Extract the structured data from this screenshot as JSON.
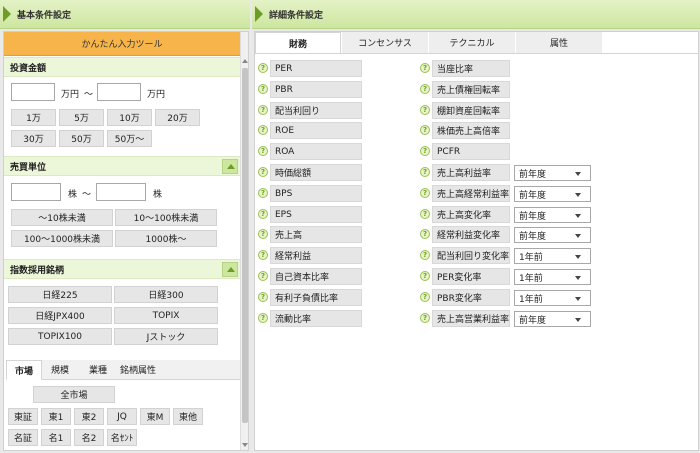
{
  "left": {
    "header": "基本条件設定",
    "easy_tool": "かんたん入力ツール",
    "investment": {
      "title": "投資金額",
      "unit1": "万円",
      "tilde": "～",
      "unit2": "万円",
      "buttons": [
        "1万",
        "5万",
        "10万",
        "20万",
        "30万",
        "50万",
        "50万～"
      ]
    },
    "trading_unit": {
      "title": "売買単位",
      "unit1": "株",
      "tilde": "～",
      "unit2": "株",
      "buttons": [
        "～10株未満",
        "10～100株未満",
        "100～1000株未満",
        "1000株～"
      ]
    },
    "index": {
      "title": "指数採用銘柄",
      "buttons": [
        "日経225",
        "日経300",
        "日経JPX400",
        "TOPIX",
        "TOPIX100",
        "Jストック"
      ]
    },
    "market_tabs": [
      "市場",
      "規模",
      "業種",
      "銘柄属性"
    ],
    "markets": [
      "全市場",
      "東証",
      "東1",
      "東2",
      "JQ",
      "東M",
      "東他",
      "名証",
      "名1",
      "名2",
      "名ｾﾝﾄ"
    ]
  },
  "right": {
    "header": "詳細条件設定",
    "tabs": [
      "財務",
      "コンセンサス",
      "テクニカル",
      "属性"
    ],
    "help_glyph": "?",
    "col1": [
      "PER",
      "PBR",
      "配当利回り",
      "ROE",
      "ROA",
      "時価総額",
      "BPS",
      "EPS",
      "売上高",
      "経常利益",
      "自己資本比率",
      "有利子負債比率",
      "流動比率"
    ],
    "col2": [
      {
        "label": "当座比率"
      },
      {
        "label": "売上債権回転率"
      },
      {
        "label": "棚卸資産回転率"
      },
      {
        "label": "株価売上高倍率"
      },
      {
        "label": "PCFR"
      },
      {
        "label": "売上高利益率",
        "select": "前年度"
      },
      {
        "label": "売上高経常利益率",
        "select": "前年度"
      },
      {
        "label": "売上高変化率",
        "select": "前年度"
      },
      {
        "label": "経常利益変化率",
        "select": "前年度"
      },
      {
        "label": "配当利回り変化率",
        "select": "1年前"
      },
      {
        "label": "PER変化率",
        "select": "1年前"
      },
      {
        "label": "PBR変化率",
        "select": "1年前"
      },
      {
        "label": "売上高営業利益率",
        "select": "前年度"
      }
    ]
  }
}
